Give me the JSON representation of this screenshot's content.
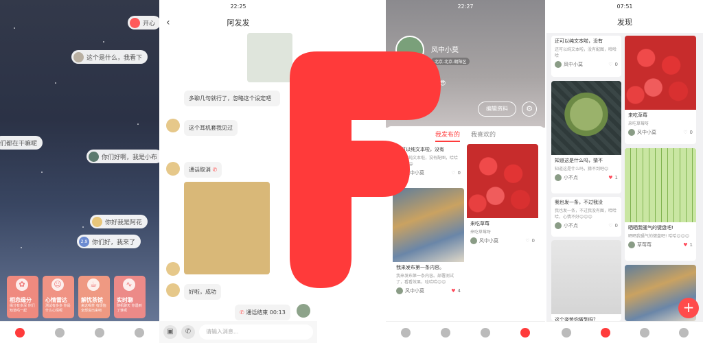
{
  "panel1": {
    "bubbles": [
      "开心",
      "这个是什么，我看下",
      "们都在干嘛呢",
      "你们好啊，我是小布",
      "你好我是阿花",
      "你们好，我来了"
    ],
    "level": "2.9",
    "cards": [
      {
        "title": "相恋缘分",
        "sub": "缘分有多深 你们知道吗一起"
      },
      {
        "title": "心情雷达",
        "sub": "测试有多多 你是什么心情呢"
      },
      {
        "title": "解忧茶馆",
        "sub": "来这喝茶 有烦恼全部说出来吧"
      },
      {
        "title": "实时聊",
        "sub": "随机聊天 你遇到了谁呢"
      }
    ]
  },
  "panel2": {
    "time": "22:25",
    "title": "阿发发",
    "messages": [
      "多聊几句就行了，忽略这个设定吧",
      "这个耳机套我见过",
      "通话取消",
      "好啦，成功",
      "通话结束 00:13"
    ],
    "input_placeholder": "请输入消息..."
  },
  "panel3": {
    "time": "22:27",
    "name": "风中小莫",
    "location": "北京-北京-朝阳区",
    "bio": "发型😎",
    "edit_label": "编辑资料",
    "tab_mine": "我发布的",
    "tab_liked": "我喜欢的",
    "posts": [
      {
        "title": "还可以纯文本啦，没有",
        "sub": "还可以纯文本啦，没有配图，哈哈哈😄😄😄",
        "author": "风中小莫",
        "likes": "0"
      },
      {
        "title": "来吃草莓",
        "sub": "来吃草莓呀",
        "author": "风中小莫",
        "likes": "0"
      },
      {
        "title": "我来发布第一条内容。",
        "sub": "我来发布第一条内容。部署测试了，看看效果，哇哈哈😊😊",
        "author": "风中小莫",
        "likes": "4"
      }
    ]
  },
  "panel4": {
    "time": "07:51",
    "title": "发现",
    "posts": [
      {
        "title": "还可以纯文本啦，没有",
        "sub": "还可以纯文本啦，没有配图，哈哈哈",
        "author": "风中小莫",
        "likes": "0"
      },
      {
        "title": "来吃草莓",
        "sub": "来吃草莓呀",
        "author": "风中小莫",
        "likes": "0"
      },
      {
        "title": "知道这是什么吗，猜不",
        "sub": "知道这是什么吗，猜不到吧😊",
        "author": "小不点",
        "likes": "1"
      },
      {
        "title": "我也发一条，不过我没",
        "sub": "我也发一条，不过我没有图，哈哈哈，心情不好😊😊😊",
        "author": "小不点",
        "likes": "0"
      },
      {
        "title": "晒晒我骚气的键盘吧!",
        "sub": "晒晒我骚气的键盘吧! 哈哈😊😊😊",
        "author": "草莓莓",
        "likes": "1"
      },
      {
        "title": "这个姿势你做到吗？",
        "sub": "",
        "author": "",
        "likes": ""
      }
    ],
    "fab": "+"
  },
  "colors": {
    "brand": "#ff3b3b",
    "tab_active": "#ff3b3b"
  }
}
